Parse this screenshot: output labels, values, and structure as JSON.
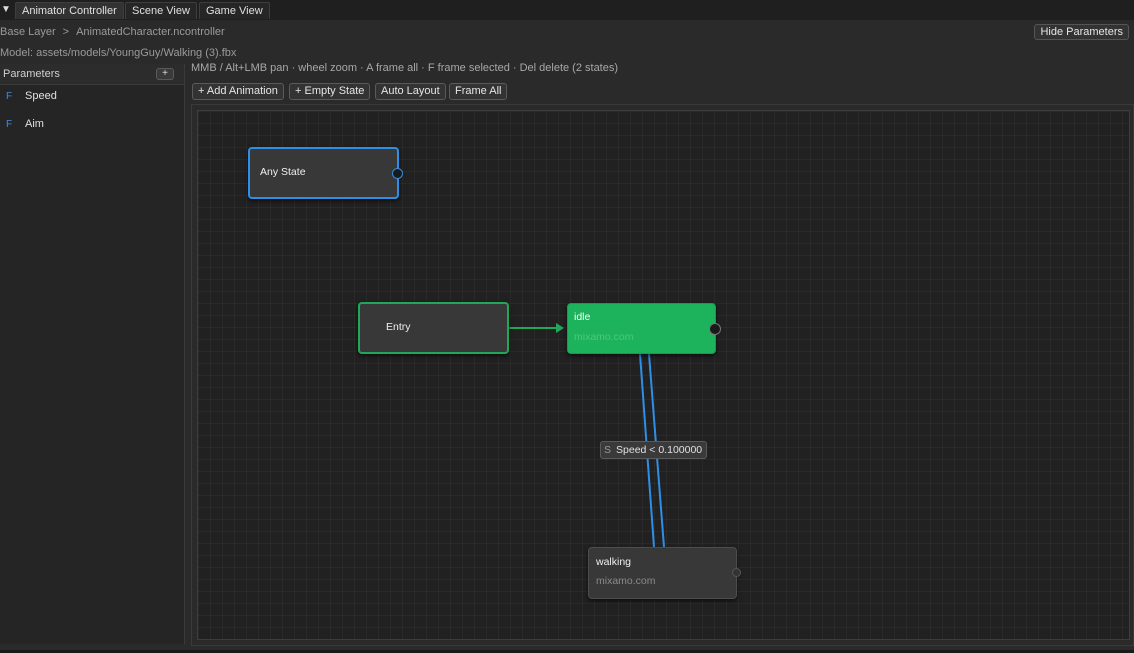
{
  "tabs": [
    {
      "label": "Animator Controller",
      "active": true
    },
    {
      "label": "Scene View",
      "active": false
    },
    {
      "label": "Game View",
      "active": false
    }
  ],
  "breadcrumb": {
    "layer": "Base Layer",
    "separator": ">",
    "controller": "AnimatedCharacter.ncontroller"
  },
  "hide_params_label": "Hide Parameters",
  "model_path": "Model: assets/models/YoungGuy/Walking (3).fbx",
  "params": {
    "title": "Parameters",
    "add_label": "+",
    "items": [
      {
        "type": "F",
        "name": "Speed"
      },
      {
        "type": "F",
        "name": "Aim"
      }
    ]
  },
  "hint": "MMB / Alt+LMB pan · wheel zoom · A frame all · F frame selected · Del delete  (2 states)",
  "toolbar": {
    "add_animation": "+ Add Animation",
    "empty_state": "+ Empty State",
    "auto_layout": "Auto Layout",
    "frame_all": "Frame All"
  },
  "graph": {
    "any_state": {
      "name": "Any State"
    },
    "entry": {
      "name": "Entry"
    },
    "idle": {
      "name": "idle",
      "clip": "mixamo.com"
    },
    "walking": {
      "name": "walking",
      "clip": "mixamo.com"
    },
    "transition": {
      "clip_prefix": "S",
      "condition": "Speed < 0.100000"
    }
  },
  "colors": {
    "any_state_border": "#2d8fe8",
    "entry_border": "#1fa85a",
    "default_state": "#1db25c",
    "transition_line": "#2d8fe8",
    "entry_line": "#1fa85a",
    "param_type": "#3a8ee6"
  }
}
